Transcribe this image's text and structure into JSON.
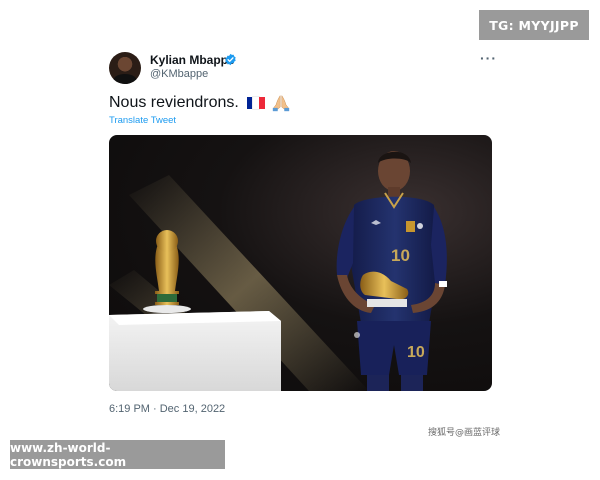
{
  "corner_badge": {
    "text": "TG: MYYJJPP"
  },
  "tweet": {
    "author_name": "Kylian Mbappé",
    "author_handle": "@KMbappe",
    "verified": true,
    "more_label": "···",
    "text": "Nous reviendrons.",
    "emojis": [
      "flag-france-icon",
      "praying-hands-icon"
    ],
    "translate_label": "Translate Tweet",
    "timestamp": "6:19 PM · Dec 19, 2022"
  },
  "photo": {
    "jersey_number": "10",
    "shorts_number": "10"
  },
  "watermark": {
    "text": "搜狐号@画蓝评球"
  },
  "site_banner": {
    "text": "www.zh-world-crownsports.com"
  },
  "colors": {
    "accent": "#1d9bf0",
    "france_blue": "#002395",
    "france_red": "#ed2939",
    "jersey": "#1c2760",
    "trophy_gold": "#c8962e",
    "banner_gray": "#9a9a9a"
  }
}
